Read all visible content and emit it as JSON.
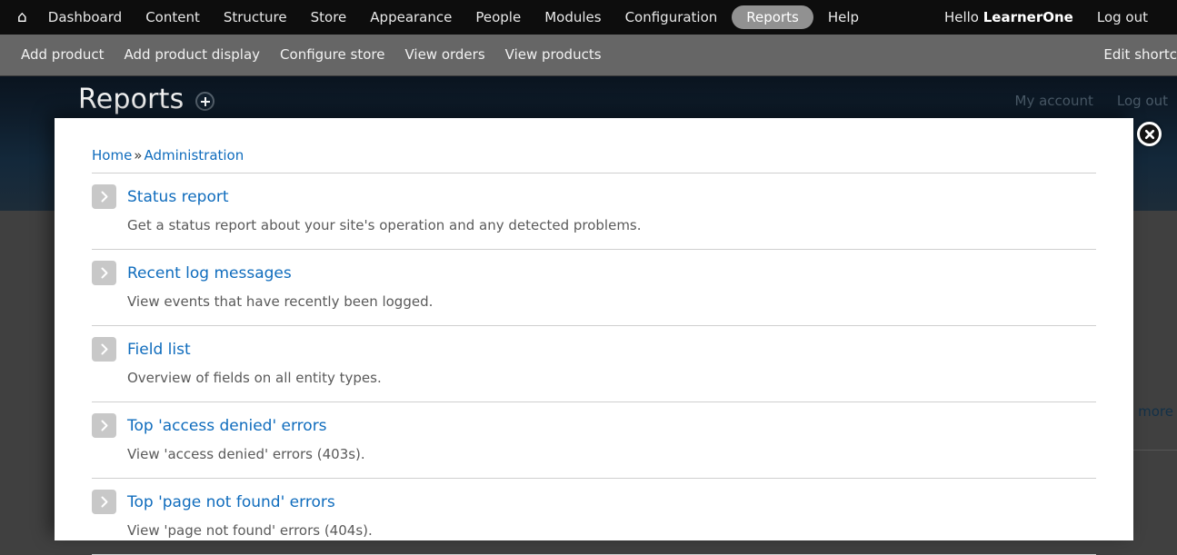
{
  "admin_toolbar": {
    "home_icon": "home-icon",
    "items": [
      {
        "label": "Dashboard",
        "active": false
      },
      {
        "label": "Content",
        "active": false
      },
      {
        "label": "Structure",
        "active": false
      },
      {
        "label": "Store",
        "active": false
      },
      {
        "label": "Appearance",
        "active": false
      },
      {
        "label": "People",
        "active": false
      },
      {
        "label": "Modules",
        "active": false
      },
      {
        "label": "Configuration",
        "active": false
      },
      {
        "label": "Reports",
        "active": true
      },
      {
        "label": "Help",
        "active": false
      }
    ],
    "greeting_prefix": "Hello ",
    "username": "LearnerOne",
    "logout_label": "Log out"
  },
  "shortcut_bar": {
    "items": [
      {
        "label": "Add product"
      },
      {
        "label": "Add product display"
      },
      {
        "label": "Configure store"
      },
      {
        "label": "View orders"
      },
      {
        "label": "View products"
      }
    ],
    "edit_label": "Edit shortc"
  },
  "banner": {
    "title": "Reports",
    "add_shortcut_icon": "circle-plus-icon",
    "my_account_label": "My account",
    "logout_label": "Log out"
  },
  "background": {
    "read_more_label": "d more"
  },
  "modal": {
    "close_icon": "close-x-icon",
    "breadcrumb": {
      "home_label": "Home",
      "separator": "»",
      "current_label": "Administration"
    },
    "items": [
      {
        "icon": "chevron-right-icon",
        "title": "Status report",
        "description": "Get a status report about your site's operation and any detected problems."
      },
      {
        "icon": "chevron-right-icon",
        "title": "Recent log messages",
        "description": "View events that have recently been logged."
      },
      {
        "icon": "chevron-right-icon",
        "title": "Field list",
        "description": "Overview of fields on all entity types."
      },
      {
        "icon": "chevron-right-icon",
        "title": "Top 'access denied' errors",
        "description": "View 'access denied' errors (403s)."
      },
      {
        "icon": "chevron-right-icon",
        "title": "Top 'page not found' errors",
        "description": "View 'page not found' errors (404s)."
      }
    ]
  },
  "colors": {
    "link": "#0f6cbd",
    "toolbar_bg": "#0d0d0d",
    "shortcut_bg": "#666666",
    "banner_top": "#0a141f",
    "banner_bottom": "#1d2c39",
    "dim_overlay": "#404040",
    "active_pill": "#919191"
  }
}
